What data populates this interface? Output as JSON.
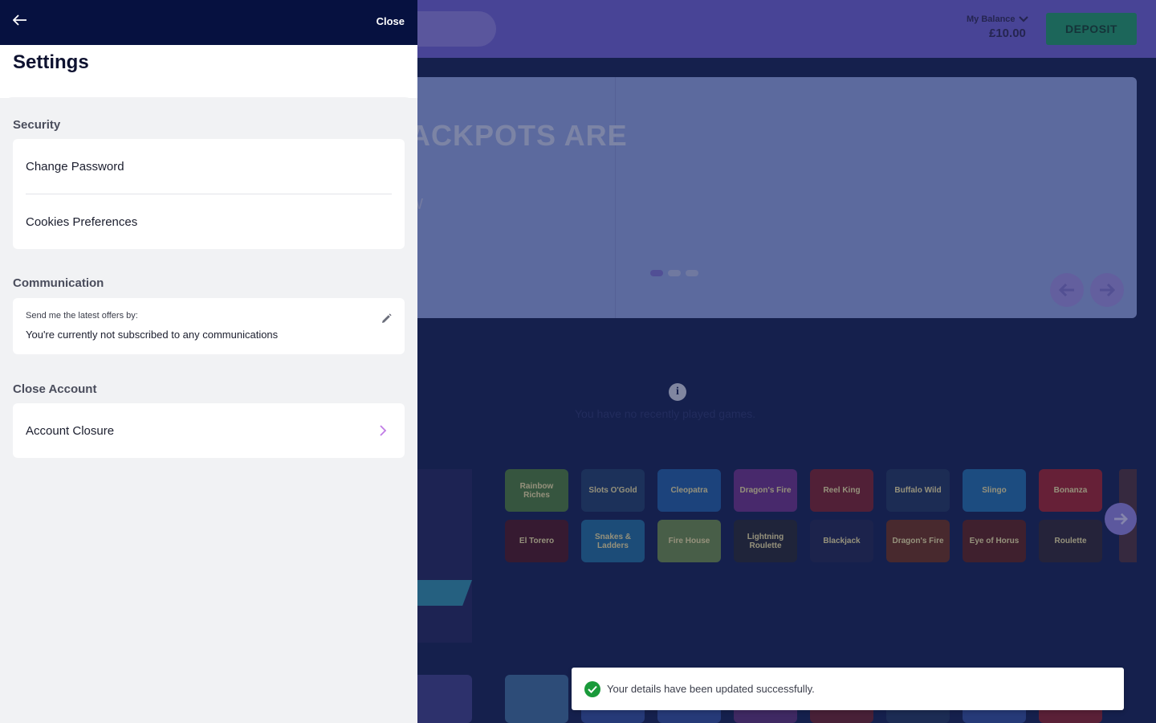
{
  "header": {
    "balance_label": "My Balance",
    "balance_amount": "£10.00",
    "deposit_label": "DEPOSIT"
  },
  "banner": {
    "title": "ACKPOTS ARE",
    "subtitle": "W"
  },
  "recent": {
    "empty_text": "You have no recently played games."
  },
  "games": {
    "row1": [
      "Rainbow Riches",
      "Slots O'Gold",
      "Cleopatra",
      "Dragon's Fire",
      "Reel King",
      "Buffalo Wild",
      "Slingo",
      "Bonanza"
    ],
    "row2": [
      "El Torero",
      "Snakes & Ladders",
      "Fire House",
      "Lightning Roulette",
      "Blackjack",
      "Dragon's Fire",
      "Eye of Horus",
      "Roulette"
    ]
  },
  "drawer": {
    "close_label": "Close",
    "title": "Settings",
    "security": {
      "title": "Security",
      "items": [
        "Change Password",
        "Cookies Preferences"
      ]
    },
    "communication": {
      "title": "Communication",
      "label": "Send me the latest offers by:",
      "value": "You're currently not subscribed to any communications"
    },
    "close_account": {
      "title": "Close Account",
      "item": "Account Closure"
    }
  },
  "toast": {
    "message": "Your details have been updated successfully."
  },
  "colors": {
    "drawer_header": "#061140",
    "accent_purple": "#c07ce6",
    "success_green": "#1a9a3a"
  }
}
